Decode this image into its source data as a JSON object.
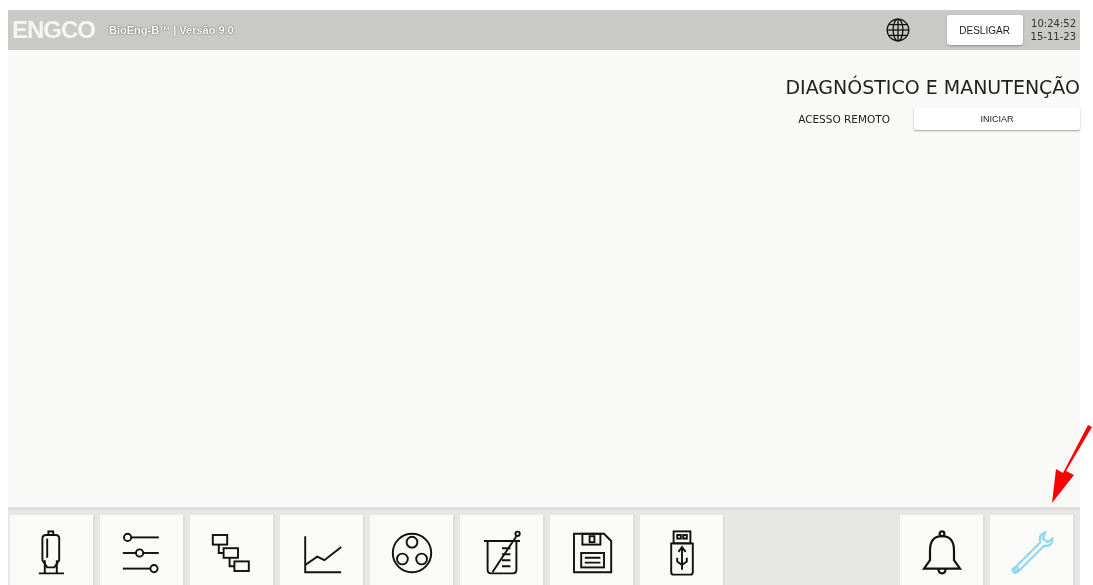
{
  "header": {
    "logo": "ENGCO",
    "product": "BioEng-B™ | Versão 9.0",
    "power_button": "DESLIGAR",
    "time": "10:24:52",
    "date": "15-11-23"
  },
  "panel": {
    "title": "DIAGNÓSTICO E MANUTENÇÃO",
    "row_label": "ACESSO REMOTO",
    "row_button": "INICIAR"
  },
  "nav_left": [
    {
      "kind": "tank",
      "selected": false
    },
    {
      "kind": "sliders",
      "selected": false
    },
    {
      "kind": "blocks",
      "selected": false
    },
    {
      "kind": "chart",
      "selected": false
    },
    {
      "kind": "circles",
      "selected": false
    },
    {
      "kind": "beaker",
      "selected": false
    },
    {
      "kind": "save",
      "selected": false
    },
    {
      "kind": "usb",
      "selected": false
    }
  ],
  "nav_right": [
    {
      "kind": "bell",
      "selected": false
    },
    {
      "kind": "wrench",
      "selected": true
    }
  ]
}
